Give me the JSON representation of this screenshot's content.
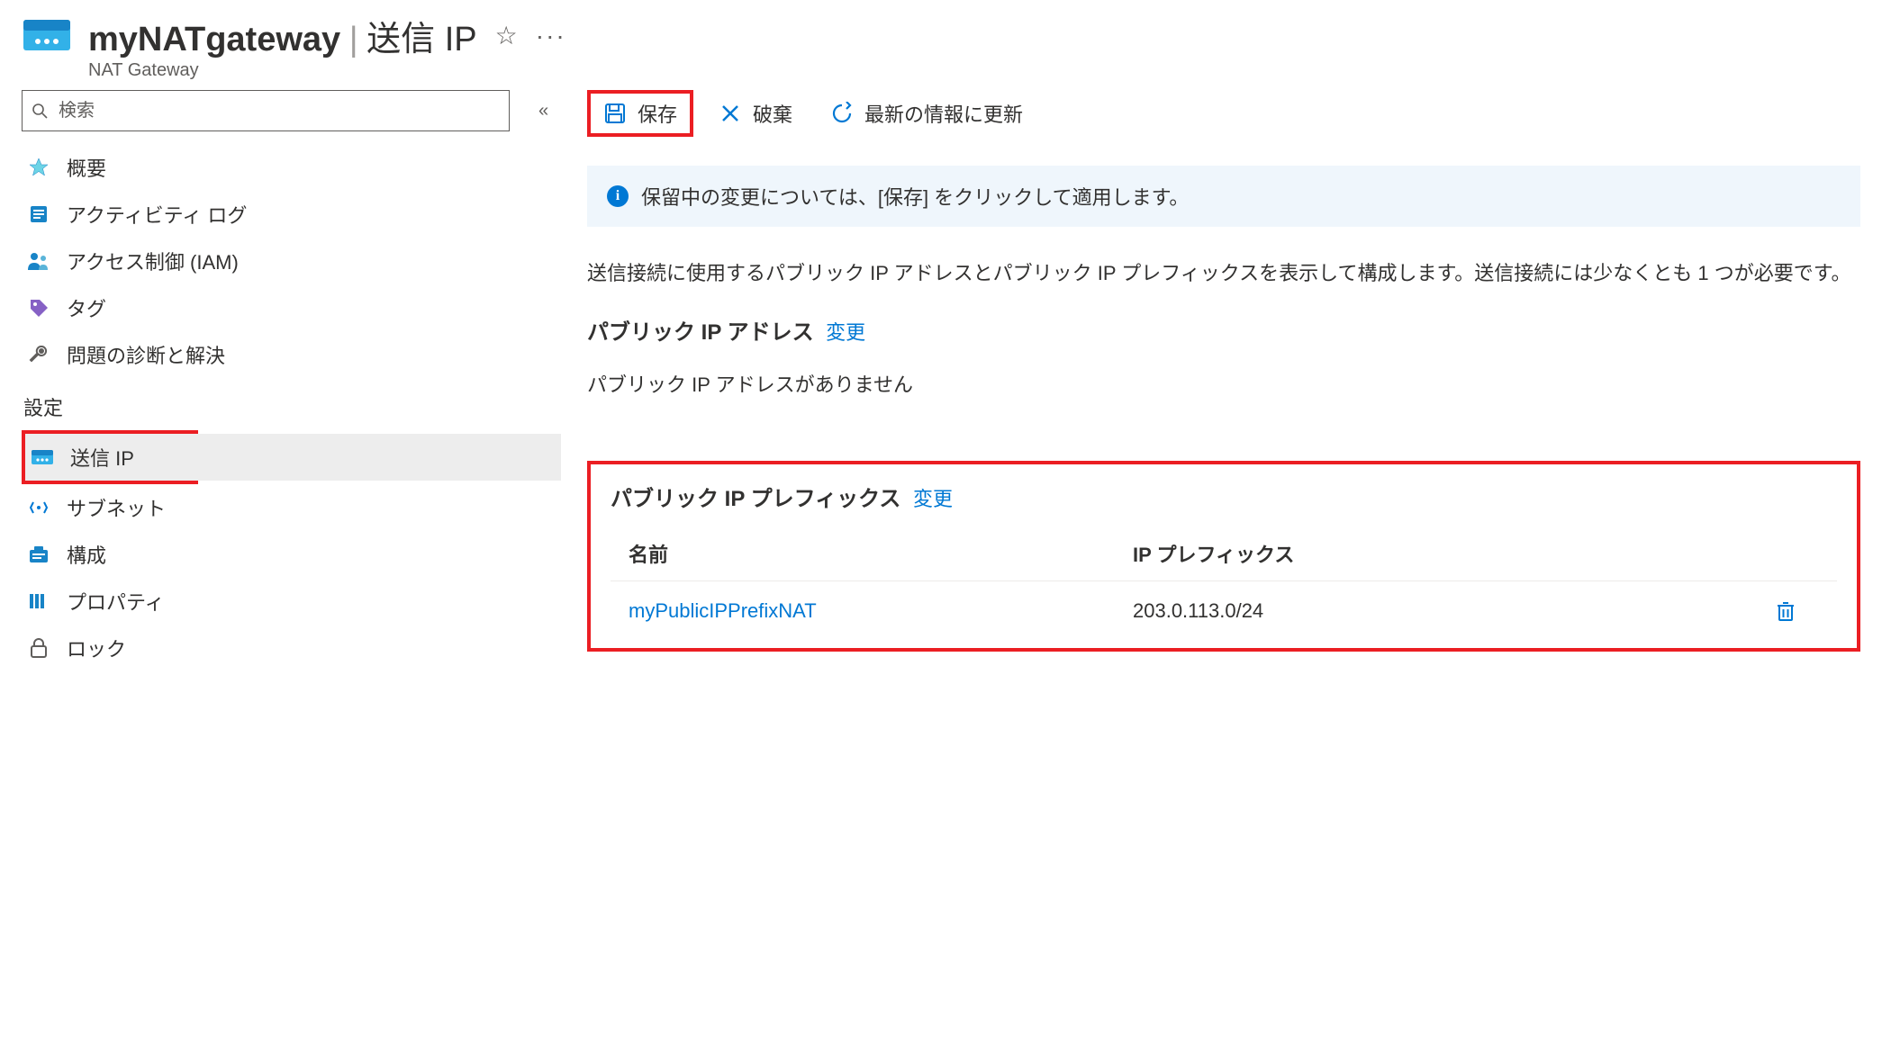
{
  "header": {
    "resource_name": "myNATgateway",
    "page_title": "送信 IP",
    "resource_type": "NAT Gateway"
  },
  "sidebar": {
    "search_placeholder": "検索",
    "items": {
      "overview": "概要",
      "activity": "アクティビティ ログ",
      "access": "アクセス制御 (IAM)",
      "tags": "タグ",
      "diagnose": "問題の診断と解決"
    },
    "settings_label": "設定",
    "settings_items": {
      "outbound_ip": "送信 IP",
      "subnet": "サブネット",
      "config": "構成",
      "properties": "プロパティ",
      "lock": "ロック"
    }
  },
  "toolbar": {
    "save": "保存",
    "discard": "破棄",
    "refresh": "最新の情報に更新"
  },
  "banner": {
    "text": "保留中の変更については、[保存] をクリックして適用します。"
  },
  "content": {
    "description": "送信接続に使用するパブリック IP アドレスとパブリック IP プレフィックスを表示して構成します。送信接続には少なくとも 1 つが必要です。",
    "ip_address_heading": "パブリック IP アドレス",
    "change_link": "変更",
    "no_ip_address": "パブリック IP アドレスがありません",
    "ip_prefix_heading": "パブリック IP プレフィックス",
    "table_headers": {
      "name": "名前",
      "prefix": "IP プレフィックス"
    },
    "prefix_rows": [
      {
        "name": "myPublicIPPrefixNAT",
        "prefix": "203.0.113.0/24"
      }
    ]
  }
}
